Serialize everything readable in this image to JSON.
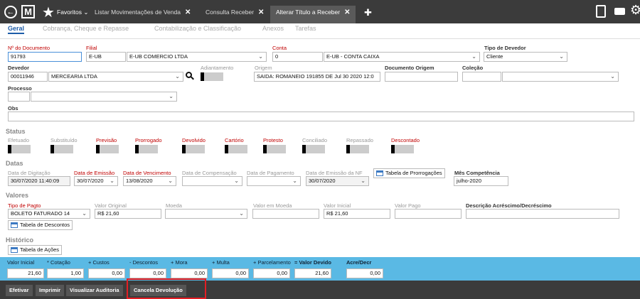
{
  "topbar": {
    "back_glyph": "←",
    "logo": "M",
    "favorites": "Favoritos",
    "favorites_chev": "⌄",
    "tabs": [
      {
        "label": "Listar Movimentações de Venda",
        "close": "✕"
      },
      {
        "label": "Consulta Receber",
        "close": "✕"
      },
      {
        "label": "Alterar Título a Receber",
        "close": "✕"
      }
    ],
    "add": "✚"
  },
  "subtabs": [
    "Geral",
    "Cobrança, Cheque e Repasse",
    "Contabilização e Classificação",
    "Anexos",
    "Tarefas"
  ],
  "doc": {
    "num_label": "Nº do Documento",
    "num_value": "91793",
    "filial_label": "Filial",
    "filial_code": "E-UB",
    "filial_name": "E-UB COMERCIO LTDA",
    "conta_label": "Conta",
    "conta_code": "0",
    "conta_name": "E-UB - CONTA CAIXA",
    "tipo_dev_label": "Tipo de Devedor",
    "tipo_dev_value": "Cliente",
    "devedor_label": "Devedor",
    "devedor_code": "00011946",
    "devedor_name": "MERCEARIA LTDA",
    "adiant_label": "Adiantamento",
    "origem_label": "Origem",
    "origem_value": "SAIDA:  ROMANEIO 191855 DE Jul 30 2020 12:0",
    "doc_origem_label": "Documento Origem",
    "colecao_label": "Coleção",
    "processo_label": "Processo",
    "obs_label": "Obs"
  },
  "status": {
    "title": "Status",
    "flags": [
      {
        "label": "Efetuado",
        "color": "gray"
      },
      {
        "label": "Substituído",
        "color": "gray"
      },
      {
        "label": "Previsão",
        "color": "red"
      },
      {
        "label": "Prorrogado",
        "color": "red"
      },
      {
        "label": "Devolvido",
        "color": "red"
      },
      {
        "label": "Cartório",
        "color": "red"
      },
      {
        "label": "Protesto",
        "color": "red"
      },
      {
        "label": "Conciliado",
        "color": "gray"
      },
      {
        "label": "Repassado",
        "color": "gray"
      },
      {
        "label": "Descontado",
        "color": "red"
      }
    ]
  },
  "datas": {
    "title": "Datas",
    "digitacao_label": "Data de Digitação",
    "digitacao_value": "30/07/2020 11:40:09",
    "emissao_label": "Data de Emissão",
    "emissao_value": "30/07/2020",
    "vencimento_label": "Data de Vencimento",
    "vencimento_value": "13/08/2020",
    "compensacao_label": "Data de Compensação",
    "pagamento_label": "Data de Pagamento",
    "emissao_nf_label": "Data de Emissão da NF",
    "emissao_nf_value": "30/07/2020",
    "prorrogacoes_btn": "Tabela de Prorrogações",
    "mes_label": "Mês Competência",
    "mes_value": "julho-2020"
  },
  "valores": {
    "title": "Valores",
    "tipo_pagto_label": "Tipo de Pagto",
    "tipo_pagto_value": "BOLETO FATURADO 14",
    "valor_original_label": "Valor Original",
    "valor_original_value": "R$ 21,60",
    "moeda_label": "Moeda",
    "valor_moeda_label": "Valor em Moeda",
    "valor_inicial_label": "Valor Inicial",
    "valor_inicial_value": "R$ 21,60",
    "valor_pago_label": "Valor Pago",
    "descricao_label": "Descrição Acréscimo/Decréscimo",
    "descontos_btn": "Tabela de Descontos"
  },
  "historico": {
    "title": "Histórico",
    "acoes_btn": "Tabela de Ações"
  },
  "totals": [
    {
      "label": "Valor Inicial",
      "value": "21,60",
      "bold": false
    },
    {
      "label": "* Cotação",
      "value": "1,00",
      "bold": false
    },
    {
      "label": "+ Custos",
      "value": "0,00",
      "bold": false
    },
    {
      "label": "- Descontos",
      "value": "0,00",
      "bold": false
    },
    {
      "label": "+ Mora",
      "value": "0,00",
      "bold": false
    },
    {
      "label": "+ Multa",
      "value": "0,00",
      "bold": false
    },
    {
      "label": "+ Parcelamento",
      "value": "0,00",
      "bold": false
    },
    {
      "label": "= Valor Devido",
      "value": "21,60",
      "bold": true
    },
    {
      "label": "Acre/Decr",
      "value": "0,00",
      "bold": true
    }
  ],
  "footer": {
    "efetivar": "Efetivar",
    "imprimir": "Imprimir",
    "auditoria": "Visualizar Auditoria",
    "cancela": "Cancela Devolução"
  },
  "colors": {
    "accent": "#1d5ca8",
    "required_label": "#c00000",
    "totals_bar": "#5ab9e4",
    "highlight": "#e31e24"
  }
}
